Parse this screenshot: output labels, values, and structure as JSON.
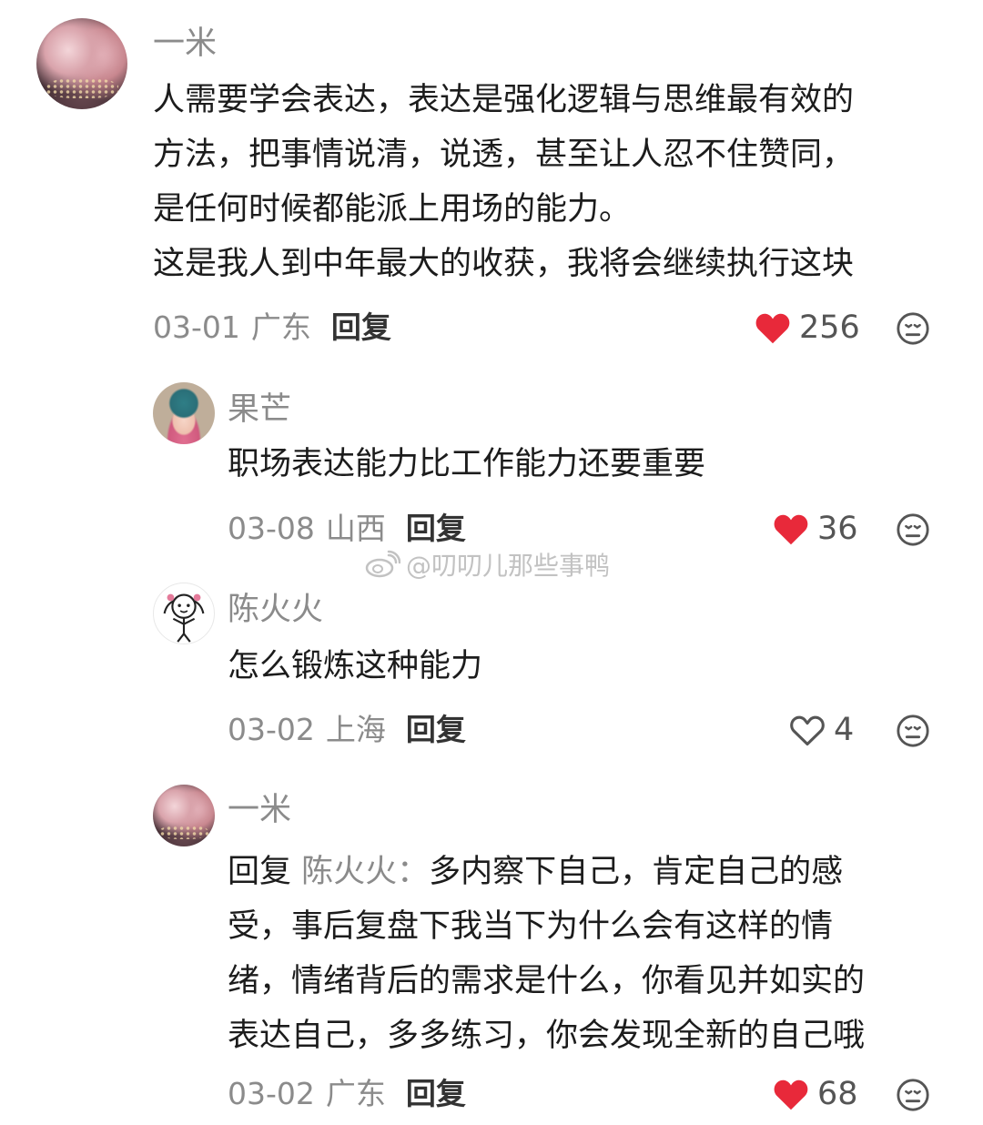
{
  "comments": [
    {
      "username": "一米",
      "lines": [
        "人需要学会表达，表达是强化逻辑与思维最有效的",
        "方法，把事情说清，说透，甚至让人忍不住赞同，",
        "是任何时候都能派上用场的能力。",
        "这是我人到中年最大的收获，我将会继续执行这块"
      ],
      "date": "03-01",
      "region": "广东",
      "reply_label": "回复",
      "likes": "256",
      "liked": true
    },
    {
      "username": "果芒",
      "lines": [
        "职场表达能力比工作能力还要重要"
      ],
      "date": "03-08",
      "region": "山西",
      "reply_label": "回复",
      "likes": "36",
      "liked": true
    },
    {
      "username": "陈火火",
      "lines": [
        "怎么锻炼这种能力"
      ],
      "date": "03-02",
      "region": "上海",
      "reply_label": "回复",
      "likes": "4",
      "liked": false
    },
    {
      "username": "一米",
      "reply_prefix": "回复",
      "reply_target": "陈火火：",
      "first_line_rest": "多内察下自己，肯定自己的感",
      "lines": [
        "受，事后复盘下我当下为什么会有这样的情",
        "绪，情绪背后的需求是什么，你看见并如实的",
        "表达自己，多多练习，你会发现全新的自己哦"
      ],
      "date": "03-02",
      "region": "广东",
      "reply_label": "回复",
      "likes": "68",
      "liked": true
    }
  ],
  "watermark": "@叨叨儿那些事鸭",
  "colors": {
    "like_red": "#e8293a",
    "muted_text": "#8b8b8b",
    "body_text": "#1c1c1c"
  },
  "icons": {
    "like": "heart-icon",
    "react": "neutral-face-icon",
    "watermark": "weibo-logo-icon"
  }
}
